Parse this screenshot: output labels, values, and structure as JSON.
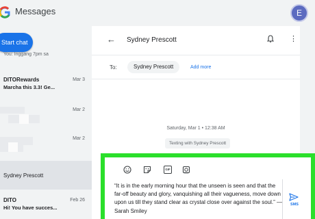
{
  "app": {
    "title": "Messages",
    "avatar_letter": "E"
  },
  "sidebar": {
    "start_chat_label": "Start chat",
    "partial_preview": "You: Inggang 7pm sa",
    "conversations": [
      {
        "name": "DITORewards",
        "preview": "Marcha this 3.3! Ge...",
        "date": "Mar 3"
      },
      {
        "name": "",
        "preview": "",
        "date": "Mar 2"
      },
      {
        "name": "",
        "preview": "",
        "date": "Mar 2"
      },
      {
        "name": "Sydney Prescott",
        "preview": "",
        "date": ""
      },
      {
        "name": "DITO",
        "preview": "Hi! You have succes...",
        "date": "Feb 26"
      }
    ]
  },
  "chat": {
    "contact_name": "Sydney Prescott",
    "to_label": "To:",
    "recipient": "Sydney Prescott",
    "add_more_label": "Add more",
    "timestamp": "Saturday, Mar 1 • 12:38 AM",
    "texting_with": "Texting with Sydney Prescott",
    "compose": {
      "text": "“It is in the early morning hour that the unseen is seen and that the far-off beauty and glory, vanquishing all their vagueness, move down upon us till they stand clear as crystal close over against the soul.” — Sarah Smiley",
      "send_label": "SMS"
    }
  },
  "colors": {
    "accent": "#1a73e8",
    "highlight": "#2bdf2b",
    "avatar": "#5c6bc0"
  }
}
